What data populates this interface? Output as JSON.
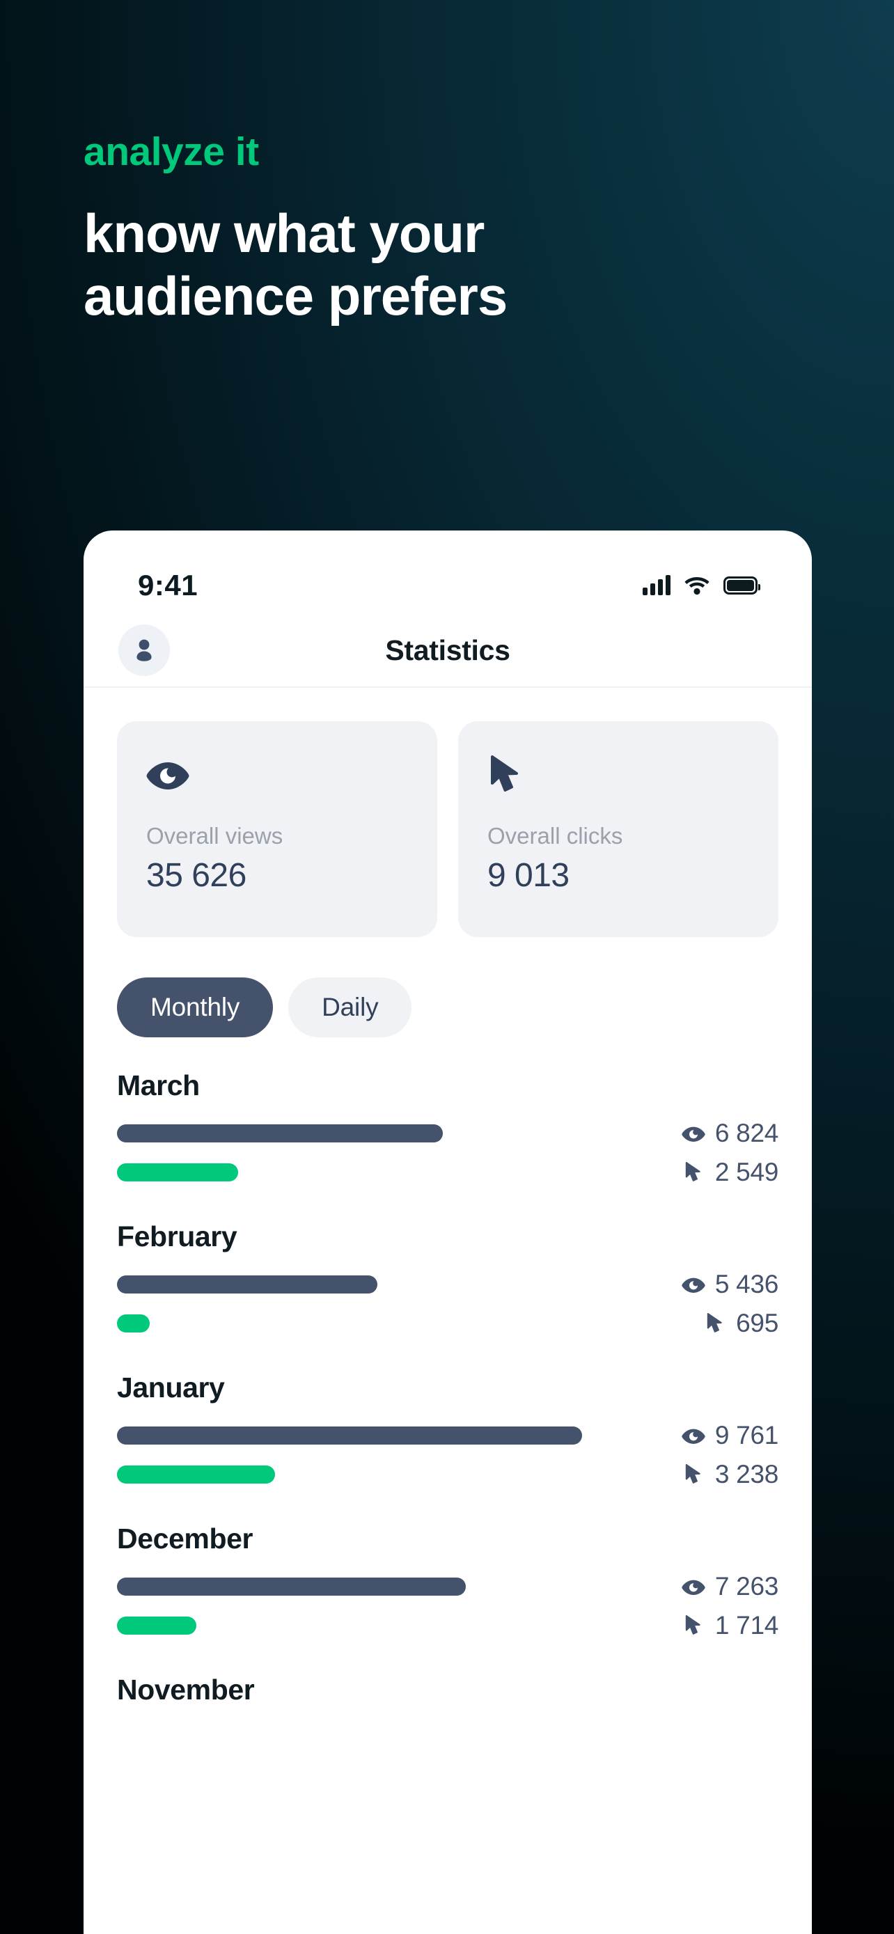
{
  "hero": {
    "eyebrow": "analyze it",
    "title": "know what your audience prefers"
  },
  "colors": {
    "accent_green": "#00c97b",
    "slate": "#44526b",
    "card_bg": "#f0f2f5",
    "background_top_right": "#0e3d4d",
    "background_bottom_left": "#000305"
  },
  "phone": {
    "status_bar": {
      "time": "9:41",
      "icons": [
        "cellular-signal-icon",
        "wifi-icon",
        "battery-icon"
      ]
    },
    "navbar": {
      "title": "Statistics",
      "avatar_icon": "person-icon"
    },
    "stat_cards": [
      {
        "icon": "eye-icon",
        "label": "Overall views",
        "value": "35 626"
      },
      {
        "icon": "cursor-arrow-icon",
        "label": "Overall clicks",
        "value": "9 013"
      }
    ],
    "segments": [
      {
        "label": "Monthly",
        "active": true
      },
      {
        "label": "Daily",
        "active": false
      }
    ]
  },
  "chart_data": {
    "type": "bar",
    "title": "Statistics",
    "orientation": "horizontal",
    "categories": [
      "March",
      "February",
      "January",
      "December",
      "November"
    ],
    "series": [
      {
        "name": "Overall views",
        "icon": "eye-icon",
        "color": "#44526b",
        "values": [
          6824,
          5436,
          9761,
          7263,
          null
        ],
        "labels": [
          "6 824",
          "5 436",
          "9 761",
          "7 263",
          ""
        ]
      },
      {
        "name": "Overall clicks",
        "icon": "cursor-arrow-icon",
        "color": "#00c97b",
        "values": [
          2549,
          695,
          3238,
          1714,
          null
        ],
        "labels": [
          "2 549",
          "695",
          "3 238",
          "1 714",
          ""
        ]
      }
    ],
    "bar_widths_pct": {
      "views": [
        70,
        56,
        100,
        75,
        0
      ],
      "clicks": [
        26,
        7,
        34,
        17,
        0
      ]
    },
    "legend": [
      "Overall views",
      "Overall clicks"
    ],
    "grid": false,
    "note": "Last row (November) is cut off at the bottom of the screen; its bars and values are not visible."
  }
}
